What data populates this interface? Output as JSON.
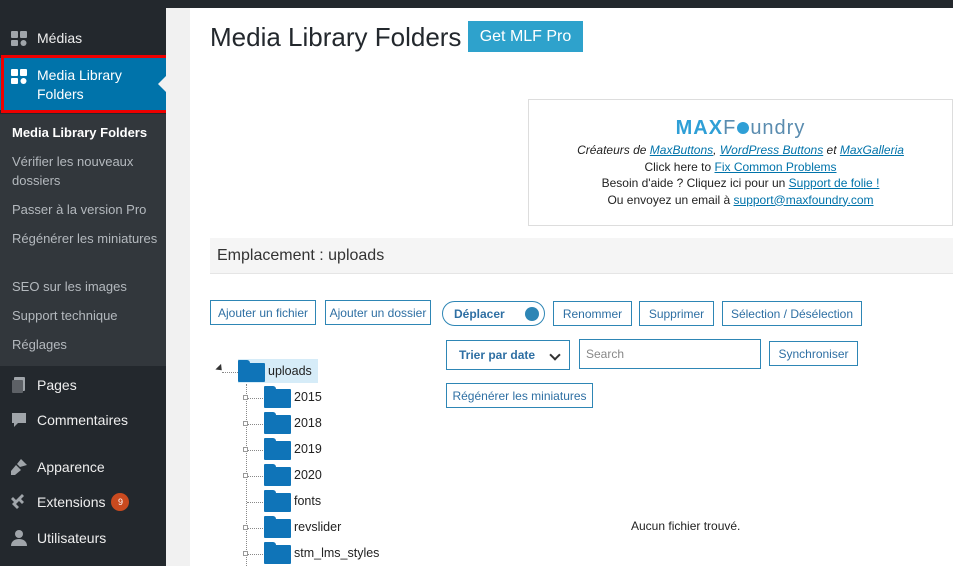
{
  "sidebar": {
    "items": [
      {
        "label": "Médias",
        "icon": "media-icon"
      },
      {
        "label": "Media Library Folders",
        "icon": "media-folders-icon"
      },
      {
        "label": "Pages",
        "icon": "pages-icon"
      },
      {
        "label": "Commentaires",
        "icon": "comments-icon"
      },
      {
        "label": "Apparence",
        "icon": "appearance-icon"
      },
      {
        "label": "Extensions",
        "icon": "plugins-icon",
        "badge": "9"
      },
      {
        "label": "Utilisateurs",
        "icon": "users-icon"
      }
    ],
    "submenu": [
      "Media Library Folders",
      "Vérifier les nouveaux dossiers",
      "Passer à la version Pro",
      "Régénérer les miniatures",
      "SEO sur les images",
      "Support technique",
      "Réglages"
    ]
  },
  "header": {
    "title": "Media Library Folders",
    "pro_button": "Get MLF Pro"
  },
  "maxfoundry": {
    "logo_a": "MAX",
    "logo_b": "F",
    "logo_c": "undry",
    "line1_prefix": "Créateurs de ",
    "link_maxbuttons": "MaxButtons",
    "comma": ", ",
    "link_wpbuttons": "WordPress Buttons",
    "and": " et ",
    "link_maxgalleria": "MaxGalleria",
    "line2_prefix": "Click here to ",
    "link_fix": "Fix Common Problems",
    "line3_prefix": "Besoin d'aide ? Cliquez ici pour un ",
    "link_support": "Support de folie !",
    "line4_prefix": "Ou envoyez un email à ",
    "link_email": "support@maxfoundry.com"
  },
  "location": "Emplacement : uploads",
  "toolbar": {
    "add_file": "Ajouter un fichier",
    "add_folder": "Ajouter un dossier",
    "move": "Déplacer",
    "rename": "Renommer",
    "delete": "Supprimer",
    "select": "Sélection / Désélection",
    "sort": "Trier par date",
    "search_placeholder": "Search",
    "sync": "Synchroniser",
    "regen": "Régénérer les miniatures"
  },
  "tree": {
    "root": "uploads",
    "children": [
      "2015",
      "2018",
      "2019",
      "2020",
      "fonts",
      "revslider",
      "stm_lms_styles"
    ]
  },
  "empty_message": "Aucun fichier trouvé."
}
